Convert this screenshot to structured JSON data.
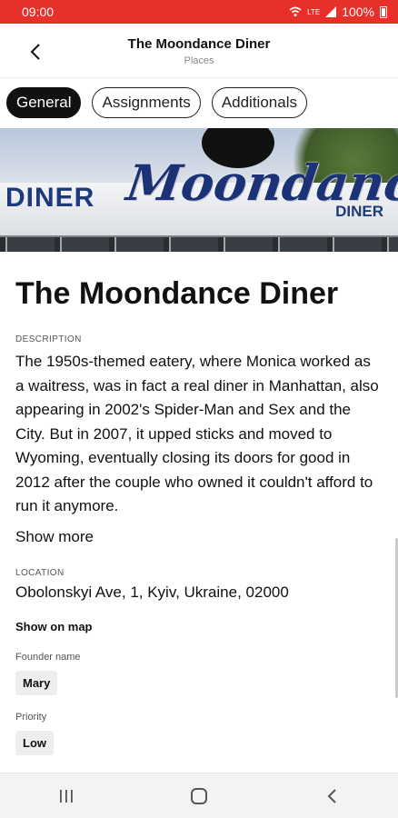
{
  "status": {
    "time": "09:00",
    "network": "LTE",
    "battery": "100%"
  },
  "appbar": {
    "title": "The Moondance Diner",
    "subtitle": "Places"
  },
  "tabs": [
    {
      "label": "General",
      "active": true
    },
    {
      "label": "Assignments",
      "active": false
    },
    {
      "label": "Additionals",
      "active": false
    }
  ],
  "hero": {
    "sign_left": "DINER",
    "sign_main": "Moondance",
    "sign_right": "DINER"
  },
  "place": {
    "title": "The Moondance Diner",
    "description_label": "DESCRIPTION",
    "description": "The 1950s-themed eatery, where Monica worked as a waitress, was in fact a real diner in Manhattan, also appearing in 2002's Spider-Man and Sex and the City. But in 2007, it upped sticks and moved to Wyoming, eventually closing its doors for good in 2012 after the couple who owned it couldn't afford to run it anymore.",
    "show_more": "Show more",
    "location_label": "LOCATION",
    "location": "Obolonskyi Ave, 1, Kyiv, Ukraine, 02000",
    "show_on_map": "Show on map",
    "founder_label": "Founder name",
    "founder_value": "Mary",
    "priority_label": "Priority",
    "priority_value": "Low"
  },
  "colors": {
    "status_bar": "#e8302a",
    "accent": "#111111"
  }
}
